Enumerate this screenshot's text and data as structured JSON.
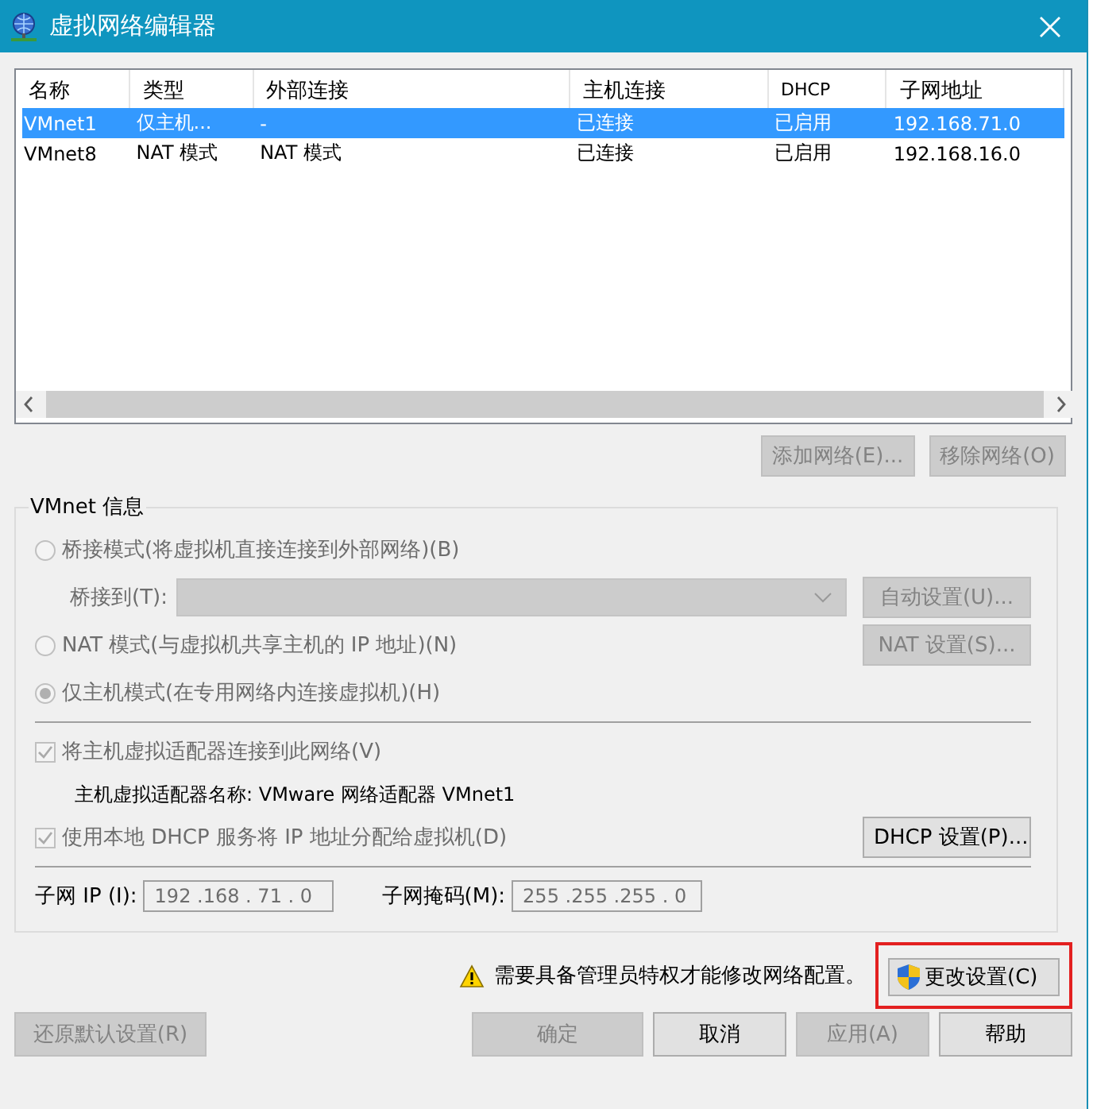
{
  "window": {
    "title": "虚拟网络编辑器"
  },
  "table": {
    "columns": [
      "名称",
      "类型",
      "外部连接",
      "主机连接",
      "DHCP",
      "子网地址"
    ],
    "rows": [
      {
        "cells": [
          "VMnet1",
          "仅主机...",
          "-",
          "已连接",
          "已启用",
          "192.168.71.0"
        ],
        "selected": true
      },
      {
        "cells": [
          "VMnet8",
          "NAT 模式",
          "NAT 模式",
          "已连接",
          "已启用",
          "192.168.16.0"
        ],
        "selected": false
      }
    ]
  },
  "network_buttons": [
    {
      "label": "添加网络(E)...",
      "disabled": true
    },
    {
      "label": "移除网络(O)",
      "disabled": true
    }
  ],
  "vmnet_info": {
    "legend": "VMnet 信息",
    "bridged_mode": {
      "label": "桥接模式(将虚拟机直接连接到外部网络)(B)",
      "selected": false,
      "disabled": true
    },
    "bridge_to": {
      "label": "桥接到(T):",
      "disabled": true
    },
    "auto_settings_button": {
      "label": "自动设置(U)...",
      "disabled": true
    },
    "nat_mode": {
      "label": "NAT 模式(与虚拟机共享主机的 IP 地址)(N)",
      "selected": false,
      "disabled": true
    },
    "nat_settings_button": {
      "label": "NAT 设置(S)...",
      "disabled": true
    },
    "host_only_mode": {
      "label": "仅主机模式(在专用网络内连接虚拟机)(H)",
      "selected": true,
      "disabled": true
    },
    "connect_adapter": {
      "label": "将主机虚拟适配器连接到此网络(V)",
      "checked": true,
      "disabled": true
    },
    "adapter_name": "主机虚拟适配器名称: VMware 网络适配器 VMnet1",
    "use_dhcp": {
      "label": "使用本地 DHCP 服务将 IP 地址分配给虚拟机(D)",
      "checked": true,
      "disabled": true
    },
    "dhcp_settings_button": {
      "label": "DHCP 设置(P)...",
      "disabled": false
    },
    "subnet_ip": {
      "label": "子网 IP (I):",
      "value": "192 .168 . 71 . 0"
    },
    "subnet_mask": {
      "label": "子网掩码(M):",
      "value": "255 .255 .255 . 0"
    }
  },
  "warning": {
    "text": "需要具备管理员特权才能修改网络配置。"
  },
  "change_settings_button": {
    "label": "更改设置(C)",
    "highlighted": true
  },
  "restore_button": {
    "label": "还原默认设置(R)",
    "disabled": true
  },
  "footer_buttons": [
    {
      "label": "确定",
      "disabled": true
    },
    {
      "label": "取消",
      "disabled": false
    },
    {
      "label": "应用(A)",
      "disabled": true
    },
    {
      "label": "帮助",
      "disabled": false
    }
  ]
}
